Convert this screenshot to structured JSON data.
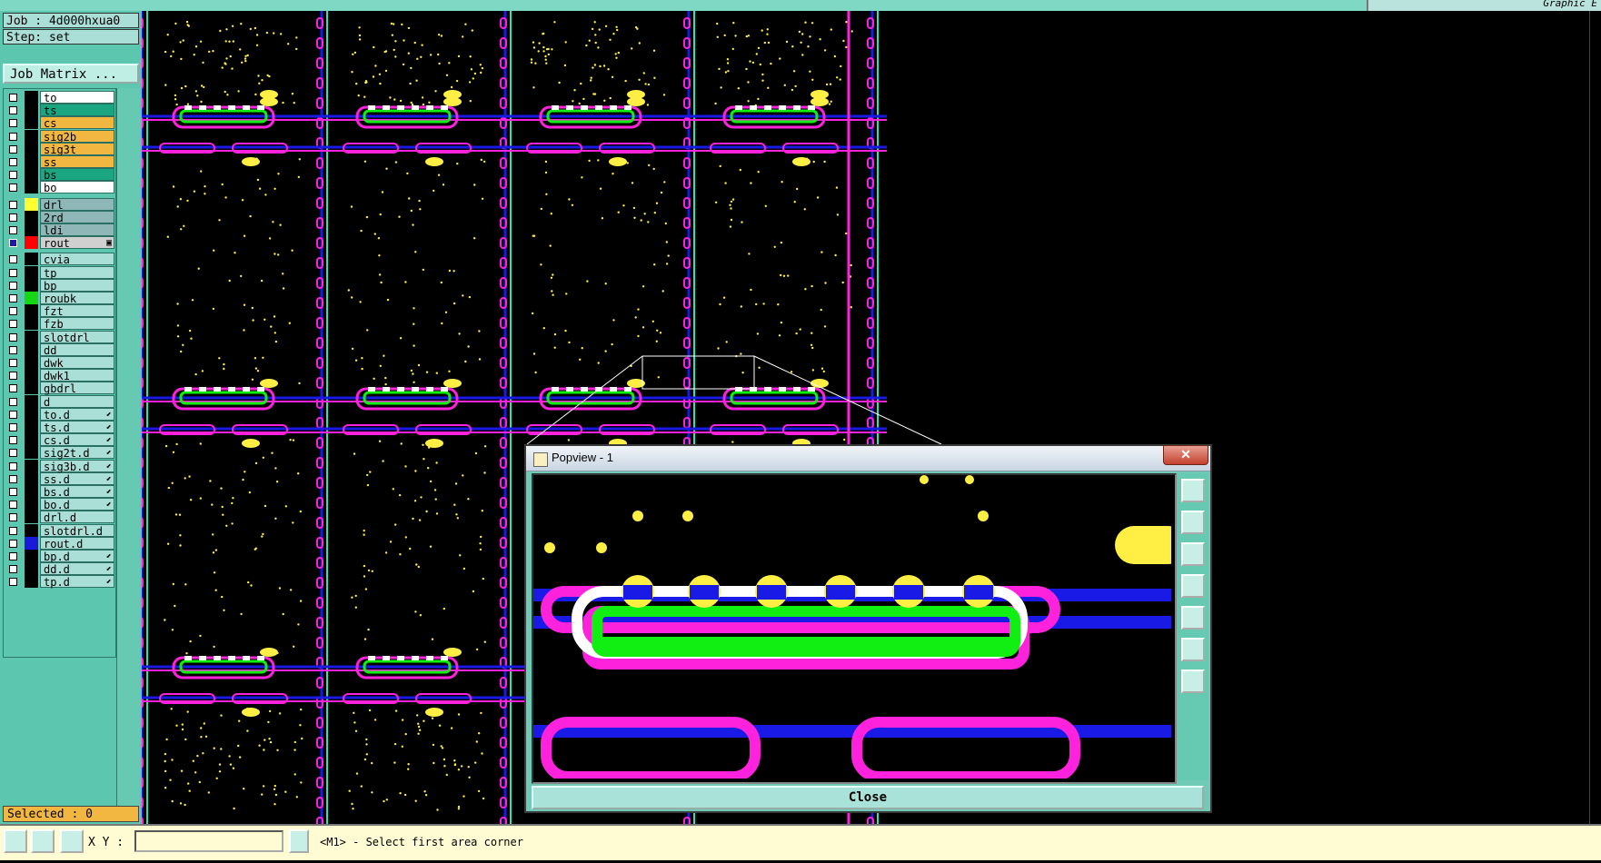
{
  "top_bar": {
    "right_label": "Graphic E"
  },
  "left_panel": {
    "job": "Job : 4d000hxua0",
    "step": "Step: set",
    "job_matrix_button": "Job Matrix ...",
    "layers": [
      {
        "name": "to",
        "color": "#ffffff",
        "swatch": "#000000",
        "flag": ""
      },
      {
        "name": "ts",
        "color": "#1aa680",
        "swatch": "#000000",
        "flag": ""
      },
      {
        "name": "cs",
        "color": "#f2b741",
        "swatch": "#000000",
        "flag": ""
      },
      {
        "name": "sig2b",
        "color": "#f2b741",
        "swatch": "#000000",
        "flag": ""
      },
      {
        "name": "sig3t",
        "color": "#f2b741",
        "swatch": "#000000",
        "flag": ""
      },
      {
        "name": "ss",
        "color": "#f2b741",
        "swatch": "#000000",
        "flag": ""
      },
      {
        "name": "bs",
        "color": "#1aa680",
        "swatch": "#000000",
        "flag": ""
      },
      {
        "name": "bo",
        "color": "#ffffff",
        "swatch": "#000000",
        "flag": ""
      },
      {
        "name": "drl",
        "color": "#8fb7b8",
        "swatch": "#ffff33",
        "flag": ""
      },
      {
        "name": "2rd",
        "color": "#8fb7b8",
        "swatch": "#000000",
        "flag": ""
      },
      {
        "name": "ldi",
        "color": "#8fb7b8",
        "swatch": "#000000",
        "flag": ""
      },
      {
        "name": "rout",
        "color": "#d0d0d0",
        "swatch": "#ff0000",
        "flag": "▣",
        "checked": true
      },
      {
        "name": "cvia",
        "color": "#a9dfd6",
        "swatch": "#000000",
        "flag": ""
      },
      {
        "name": "tp",
        "color": "#a9dfd6",
        "swatch": "#000000",
        "flag": ""
      },
      {
        "name": "bp",
        "color": "#a9dfd6",
        "swatch": "#000000",
        "flag": ""
      },
      {
        "name": "roubk",
        "color": "#a9dfd6",
        "swatch": "#16d616",
        "flag": ""
      },
      {
        "name": "fzt",
        "color": "#a9dfd6",
        "swatch": "#000000",
        "flag": ""
      },
      {
        "name": "fzb",
        "color": "#a9dfd6",
        "swatch": "#000000",
        "flag": ""
      },
      {
        "name": "slotdrl",
        "color": "#a9dfd6",
        "swatch": "#000000",
        "flag": ""
      },
      {
        "name": "dd",
        "color": "#a9dfd6",
        "swatch": "#000000",
        "flag": ""
      },
      {
        "name": "dwk",
        "color": "#a9dfd6",
        "swatch": "#000000",
        "flag": ""
      },
      {
        "name": "dwk1",
        "color": "#a9dfd6",
        "swatch": "#000000",
        "flag": ""
      },
      {
        "name": "gbdrl",
        "color": "#a9dfd6",
        "swatch": "#000000",
        "flag": ""
      },
      {
        "name": "d",
        "color": "#a9dfd6",
        "swatch": "#000000",
        "flag": ""
      },
      {
        "name": "to.d",
        "color": "#a9dfd6",
        "swatch": "#000000",
        "flag": "⬋"
      },
      {
        "name": "ts.d",
        "color": "#a9dfd6",
        "swatch": "#000000",
        "flag": "⬋"
      },
      {
        "name": "cs.d",
        "color": "#a9dfd6",
        "swatch": "#000000",
        "flag": "⬋"
      },
      {
        "name": "sig2t.d",
        "color": "#a9dfd6",
        "swatch": "#000000",
        "flag": "⬋"
      },
      {
        "name": "sig3b.d",
        "color": "#a9dfd6",
        "swatch": "#000000",
        "flag": "⬋"
      },
      {
        "name": "ss.d",
        "color": "#a9dfd6",
        "swatch": "#000000",
        "flag": "⬋"
      },
      {
        "name": "bs.d",
        "color": "#a9dfd6",
        "swatch": "#000000",
        "flag": "⬋"
      },
      {
        "name": "bo.d",
        "color": "#a9dfd6",
        "swatch": "#000000",
        "flag": "⬋"
      },
      {
        "name": "drl.d",
        "color": "#a9dfd6",
        "swatch": "#000000",
        "flag": ""
      },
      {
        "name": "slotdrl.d",
        "color": "#a9dfd6",
        "swatch": "#000000",
        "flag": ""
      },
      {
        "name": "rout.d",
        "color": "#a9dfd6",
        "swatch": "#1a1ad8",
        "flag": ""
      },
      {
        "name": "bp.d",
        "color": "#a9dfd6",
        "swatch": "#000000",
        "flag": "⬋"
      },
      {
        "name": "dd.d",
        "color": "#a9dfd6",
        "swatch": "#000000",
        "flag": "⬋"
      },
      {
        "name": "tp.d",
        "color": "#a9dfd6",
        "swatch": "#000000",
        "flag": "⬋"
      }
    ],
    "selected": "Selected : 0"
  },
  "status_bar": {
    "xy_label": "X Y :",
    "xy_value": "",
    "prompt": "<M1> - Select first area corner"
  },
  "popview": {
    "title": "Popview - 1",
    "close_label": "Close",
    "close_x": "✕"
  },
  "colors": {
    "outline_pink": "#ff22dd",
    "trace_blue": "#1a1ae6",
    "trace_cyan": "#22e6c0",
    "pad_yellow": "#ffee44",
    "rout_green": "#11ee11",
    "panel_teal": "#5cc6ae"
  }
}
